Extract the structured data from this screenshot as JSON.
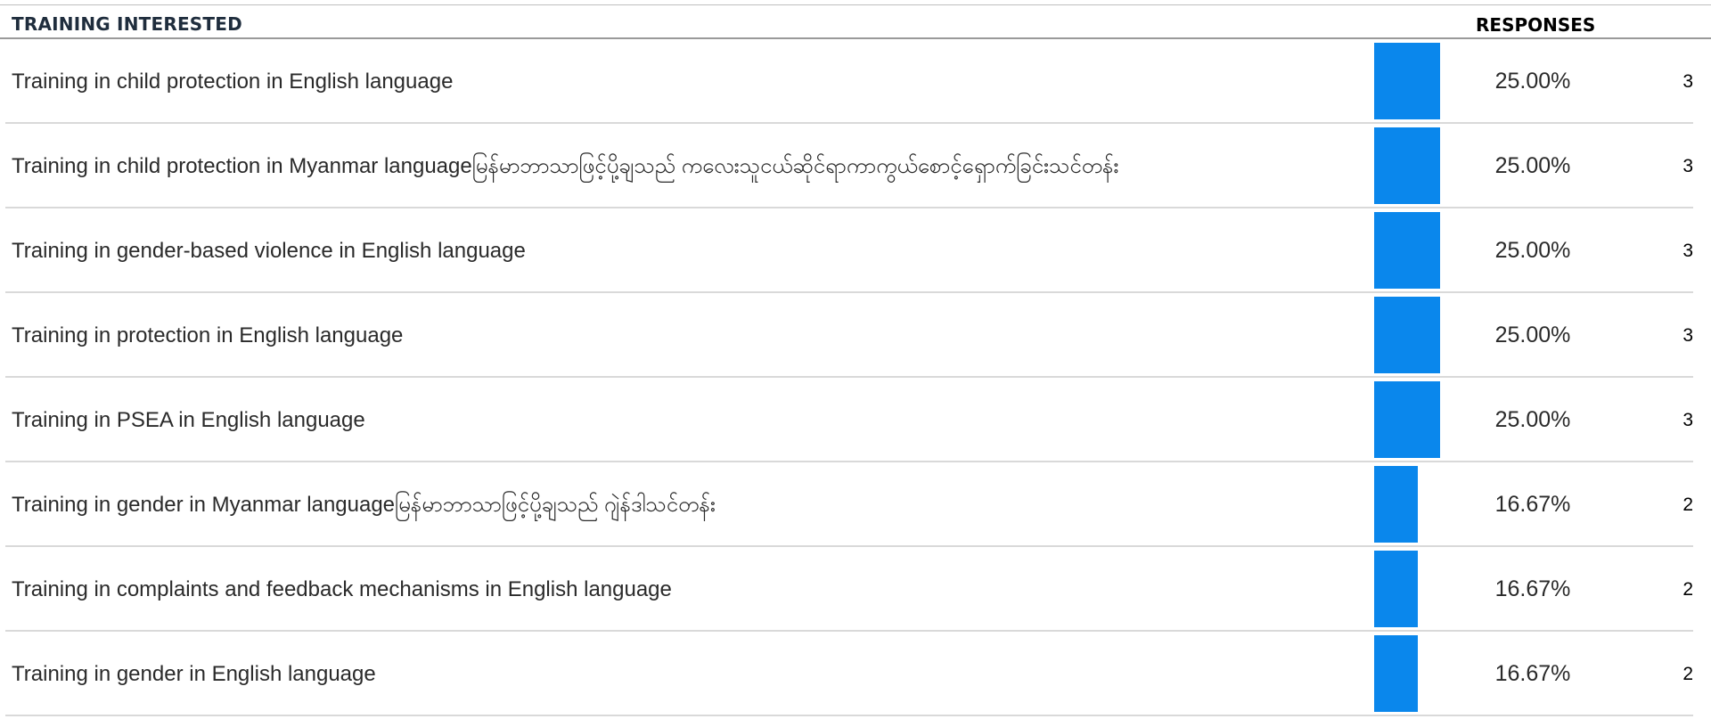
{
  "header": {
    "label_column": "TRAINING INTERESTED",
    "responses_column": "RESPONSES"
  },
  "colors": {
    "bar": "#0a87ec",
    "separator": "#d9d9d9"
  },
  "chart_data": {
    "type": "bar",
    "orientation": "horizontal",
    "value_unit": "percent",
    "xlim": [
      0,
      100
    ],
    "categories": [
      "Training in child protection in English language",
      "Training in child protection in Myanmar languageမြန်မာဘာသာဖြင့်ပို့ချသည် ကလေးသူငယ်ဆိုင်ရာကာကွယ်စောင့်ရှောက်ခြင်းသင်တန်း",
      "Training in gender-based violence in English language",
      "Training in protection in English language",
      "Training in PSEA in English language",
      "Training in gender in Myanmar languageမြန်မာဘာသာဖြင့်ပို့ချသည် ဂျဲန်ဒါသင်တန်း",
      "Training in complaints and feedback mechanisms in English language",
      "Training in gender in English language"
    ],
    "values": [
      25.0,
      25.0,
      25.0,
      25.0,
      25.0,
      16.67,
      16.67,
      16.67
    ],
    "percent_labels": [
      "25.00%",
      "25.00%",
      "25.00%",
      "25.00%",
      "25.00%",
      "16.67%",
      "16.67%",
      "16.67%"
    ],
    "counts": [
      "3",
      "3",
      "3",
      "3",
      "3",
      "2",
      "2",
      "2"
    ]
  }
}
